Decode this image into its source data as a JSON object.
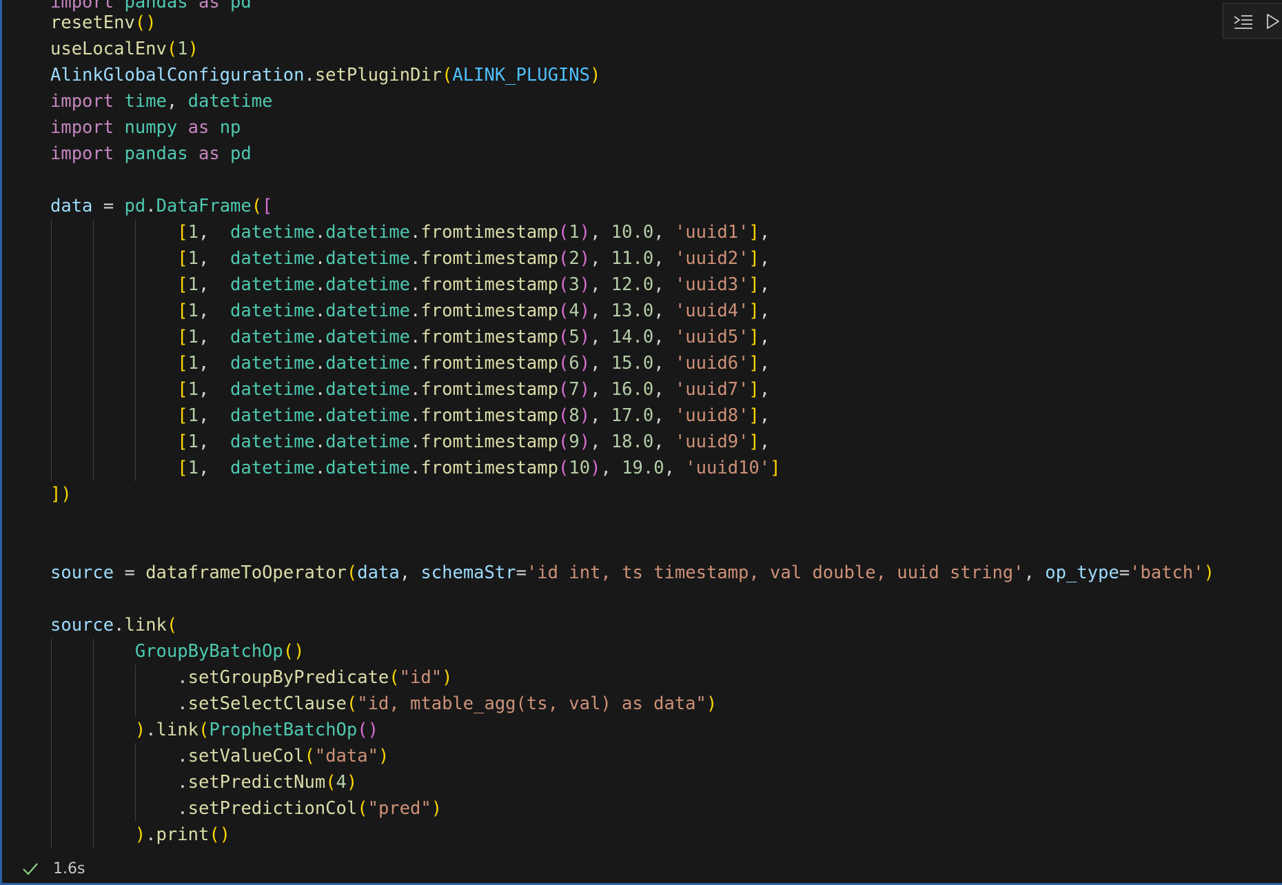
{
  "cell": {
    "status": {
      "icon": "check-icon",
      "duration": "1.6s"
    },
    "toolbar": {
      "buttons": [
        {
          "icon": "execute-above-cells-icon"
        },
        {
          "icon": "run-cell-icon"
        }
      ]
    },
    "code": {
      "line_01": "import pandas as pd",
      "line_02": "resetEnv()",
      "line_03": "useLocalEnv(1)",
      "line_04": "AlinkGlobalConfiguration.setPluginDir(ALINK_PLUGINS)",
      "line_05": "import time, datetime",
      "line_06": "import numpy as np",
      "line_07": "import pandas as pd",
      "line_08": "",
      "line_09": "data = pd.DataFrame([",
      "line_10": "            [1,  datetime.datetime.fromtimestamp(1), 10.0, 'uuid1'],",
      "line_11": "            [1,  datetime.datetime.fromtimestamp(2), 11.0, 'uuid2'],",
      "line_12": "            [1,  datetime.datetime.fromtimestamp(3), 12.0, 'uuid3'],",
      "line_13": "            [1,  datetime.datetime.fromtimestamp(4), 13.0, 'uuid4'],",
      "line_14": "            [1,  datetime.datetime.fromtimestamp(5), 14.0, 'uuid5'],",
      "line_15": "            [1,  datetime.datetime.fromtimestamp(6), 15.0, 'uuid6'],",
      "line_16": "            [1,  datetime.datetime.fromtimestamp(7), 16.0, 'uuid7'],",
      "line_17": "            [1,  datetime.datetime.fromtimestamp(8), 17.0, 'uuid8'],",
      "line_18": "            [1,  datetime.datetime.fromtimestamp(9), 18.0, 'uuid9'],",
      "line_19": "            [1,  datetime.datetime.fromtimestamp(10), 19.0, 'uuid10']",
      "line_20": "])",
      "line_21": "",
      "line_22": "",
      "line_23": "source = dataframeToOperator(data, schemaStr='id int, ts timestamp, val double, uuid string', op_type='batch')",
      "line_24": "",
      "line_25": "source.link(",
      "line_26": "        GroupByBatchOp()",
      "line_27": "            .setGroupByPredicate(\"id\")",
      "line_28": "            .setSelectClause(\"id, mtable_agg(ts, val) as data\")",
      "line_29": "        ).link(ProphetBatchOp()",
      "line_30": "            .setValueCol(\"data\")",
      "line_31": "            .setPredictNum(4)",
      "line_32": "            .setPredictionCol(\"pred\")",
      "line_33": "        ).print()"
    },
    "colors": {
      "background": "#181818",
      "cell_border": "#2b5fa6",
      "keyword": "#c586c0",
      "function": "#dcdcaa",
      "class": "#4ec9b0",
      "variable": "#9cdcfe",
      "constant": "#4fc1ff",
      "number": "#b5cea8",
      "string": "#ce9178",
      "bracket_1": "#ffd700",
      "bracket_2": "#da70d6",
      "bracket_3": "#179fff"
    }
  }
}
